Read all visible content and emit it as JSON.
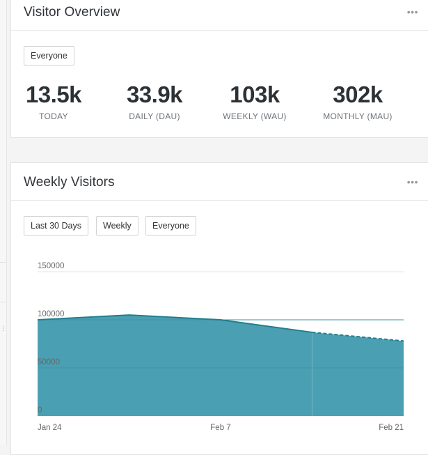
{
  "visitor_overview": {
    "title": "Visitor Overview",
    "menu_icon": "more-horizontal-icon",
    "segment_filter": "Everyone",
    "stats": [
      {
        "value": "13.5k",
        "label": "TODAY"
      },
      {
        "value": "33.9k",
        "label": "DAILY (DAU)"
      },
      {
        "value": "103k",
        "label": "WEEKLY (WAU)"
      },
      {
        "value": "302k",
        "label": "MONTHLY (MAU)"
      }
    ]
  },
  "weekly_visitors": {
    "title": "Weekly Visitors",
    "menu_icon": "more-horizontal-icon",
    "filters": {
      "range": "Last 30 Days",
      "interval": "Weekly",
      "segment": "Everyone"
    }
  },
  "chart_data": {
    "type": "area",
    "x_ticks": [
      "Jan 24",
      "Feb 7",
      "Feb 21"
    ],
    "y_ticks": [
      "150000",
      "100000",
      "50000",
      "0"
    ],
    "ylim": [
      0,
      150000
    ],
    "x": [
      "Jan 24",
      "Jan 31",
      "Feb 7",
      "Feb 14",
      "Feb 21"
    ],
    "values": [
      100000,
      105000,
      100000,
      87000,
      78000
    ],
    "projected_from_index": 3,
    "grid": true,
    "color": "#4aa0b2",
    "line_color": "#237e8e"
  }
}
